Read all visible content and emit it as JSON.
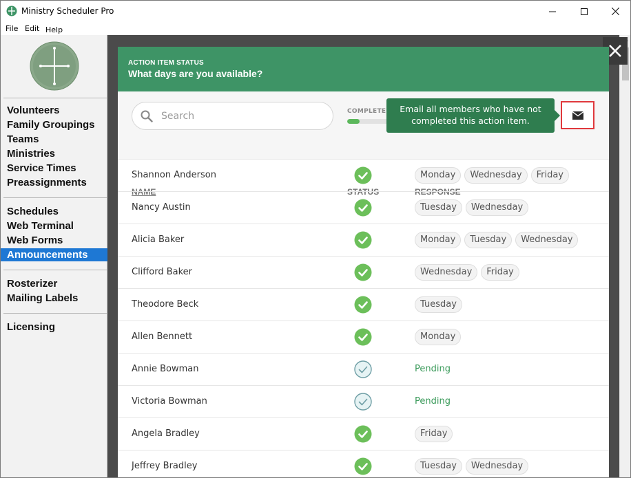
{
  "window": {
    "title": "Ministry Scheduler Pro"
  },
  "menu": [
    "File",
    "Edit",
    "Help"
  ],
  "sidebar": {
    "groups": [
      [
        "Volunteers",
        "Family Groupings",
        "Teams",
        "Ministries",
        "Service Times",
        "Preassignments"
      ],
      [
        "Schedules",
        "Web Terminal",
        "Web Forms",
        "Announcements"
      ],
      [
        "Rosterizer",
        "Mailing Labels"
      ],
      [
        "Licensing"
      ]
    ],
    "active": "Announcements"
  },
  "panel": {
    "kicker": "ACTION ITEM STATUS",
    "title": "What days are you available?",
    "search_placeholder": "Search",
    "completed_label": "COMPLETED",
    "progress_fraction": 0.08,
    "tooltip": "Email all members who have not completed this action item.",
    "columns": {
      "name": "NAME",
      "status": "STATUS",
      "response": "RESPONSE"
    }
  },
  "rows": [
    {
      "name": "Shannon Anderson",
      "status": "completed",
      "responses": [
        "Monday",
        "Wednesday",
        "Friday"
      ]
    },
    {
      "name": "Nancy Austin",
      "status": "completed",
      "responses": [
        "Tuesday",
        "Wednesday"
      ]
    },
    {
      "name": "Alicia Baker",
      "status": "completed",
      "responses": [
        "Monday",
        "Tuesday",
        "Wednesday"
      ]
    },
    {
      "name": "Clifford Baker",
      "status": "completed",
      "responses": [
        "Wednesday",
        "Friday"
      ]
    },
    {
      "name": "Theodore Beck",
      "status": "completed",
      "responses": [
        "Tuesday"
      ]
    },
    {
      "name": "Allen Bennett",
      "status": "completed",
      "responses": [
        "Monday"
      ]
    },
    {
      "name": "Annie Bowman",
      "status": "pending",
      "pending_label": "Pending",
      "responses": []
    },
    {
      "name": "Victoria Bowman",
      "status": "pending",
      "pending_label": "Pending",
      "responses": []
    },
    {
      "name": "Angela Bradley",
      "status": "completed",
      "responses": [
        "Friday"
      ]
    },
    {
      "name": "Jeffrey Bradley",
      "status": "completed",
      "responses": [
        "Tuesday",
        "Wednesday"
      ]
    }
  ],
  "colors": {
    "accent_green": "#3e9466",
    "tooltip_green": "#2f7d4f",
    "check_green": "#6cbf5a",
    "active_nav": "#1e78d4",
    "highlight_red": "#e0383c"
  }
}
